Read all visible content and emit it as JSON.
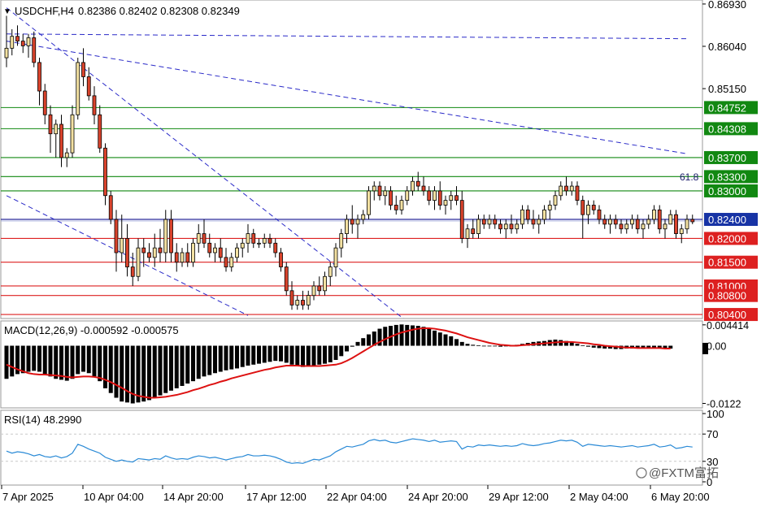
{
  "header": {
    "arrow": "▼",
    "symbol": "USDCHF,H4",
    "ohlc": "0.82386 0.82402 0.82308 0.82349"
  },
  "fib_label": "61.8",
  "macd_label": "MACD(12,26,9) -0.000592 -0.000575",
  "rsi_label": "RSI(14) 48.2990",
  "watermark": "@FXTM富拓",
  "colors": {
    "up_candle": "#f3e1a2",
    "down_candle": "#d9432c",
    "wick": "#000000",
    "support": "#dd2020",
    "resistance": "#118811",
    "current": "#2a2a9a",
    "trendline": "#2a2ac8",
    "price_tag": "#1733a5",
    "macd_signal": "#dd1111",
    "rsi_line": "#2a8ad6",
    "grid": "#c9c9c9"
  },
  "chart_data": {
    "type": "candlestick",
    "title": "USDCHF,H4",
    "y_axis_price_ticks": [
      "0.86930",
      "0.86040",
      "0.85150"
    ],
    "ylim": [
      0.8035,
      0.8698
    ],
    "level_lines": [
      {
        "label": "0.84752",
        "value": 0.84752,
        "kind": "resistance"
      },
      {
        "label": "0.84308",
        "value": 0.84308,
        "kind": "resistance"
      },
      {
        "label": "0.83700",
        "value": 0.837,
        "kind": "resistance"
      },
      {
        "label": "0.83300",
        "value": 0.833,
        "kind": "resistance"
      },
      {
        "label": "0.83000",
        "value": 0.83,
        "kind": "resistance"
      },
      {
        "label": "0.82400",
        "value": 0.824,
        "kind": "current"
      },
      {
        "label": "0.82000",
        "value": 0.82,
        "kind": "support"
      },
      {
        "label": "0.81500",
        "value": 0.815,
        "kind": "support"
      },
      {
        "label": "0.81000",
        "value": 0.81,
        "kind": "support"
      },
      {
        "label": "0.80800",
        "value": 0.808,
        "kind": "support"
      },
      {
        "label": "0.80400",
        "value": 0.804,
        "kind": "support"
      }
    ],
    "x_tick_labels": [
      "7 Apr 2025",
      "10 Apr 04:00",
      "14 Apr 20:00",
      "17 Apr 12:00",
      "22 Apr 04:00",
      "24 Apr 20:00",
      "29 Apr 12:00",
      "2 May 04:00",
      "6 May 20:00"
    ],
    "ohlc": [
      [
        0.858,
        0.8668,
        0.856,
        0.86
      ],
      [
        0.86,
        0.864,
        0.8585,
        0.8625
      ],
      [
        0.8625,
        0.8648,
        0.8605,
        0.8615
      ],
      [
        0.8615,
        0.863,
        0.859,
        0.8605
      ],
      [
        0.8605,
        0.863,
        0.858,
        0.8622
      ],
      [
        0.8622,
        0.8635,
        0.856,
        0.857
      ],
      [
        0.857,
        0.858,
        0.848,
        0.851
      ],
      [
        0.851,
        0.8525,
        0.844,
        0.846
      ],
      [
        0.846,
        0.848,
        0.838,
        0.842
      ],
      [
        0.842,
        0.845,
        0.837,
        0.844
      ],
      [
        0.844,
        0.846,
        0.835,
        0.837
      ],
      [
        0.837,
        0.839,
        0.835,
        0.838
      ],
      [
        0.838,
        0.848,
        0.837,
        0.846
      ],
      [
        0.846,
        0.858,
        0.845,
        0.857
      ],
      [
        0.857,
        0.86,
        0.852,
        0.854
      ],
      [
        0.854,
        0.856,
        0.849,
        0.85
      ],
      [
        0.85,
        0.852,
        0.844,
        0.846
      ],
      [
        0.846,
        0.848,
        0.838,
        0.839
      ],
      [
        0.839,
        0.84,
        0.827,
        0.829
      ],
      [
        0.829,
        0.83,
        0.823,
        0.824
      ],
      [
        0.824,
        0.826,
        0.813,
        0.817
      ],
      [
        0.817,
        0.825,
        0.815,
        0.82
      ],
      [
        0.82,
        0.823,
        0.812,
        0.814
      ],
      [
        0.814,
        0.817,
        0.81,
        0.812
      ],
      [
        0.812,
        0.82,
        0.811,
        0.818
      ],
      [
        0.818,
        0.82,
        0.814,
        0.817
      ],
      [
        0.817,
        0.819,
        0.815,
        0.816
      ],
      [
        0.816,
        0.821,
        0.814,
        0.818
      ],
      [
        0.818,
        0.822,
        0.815,
        0.817
      ],
      [
        0.817,
        0.826,
        0.815,
        0.824
      ],
      [
        0.824,
        0.826,
        0.815,
        0.817
      ],
      [
        0.817,
        0.819,
        0.813,
        0.815
      ],
      [
        0.815,
        0.818,
        0.814,
        0.817
      ],
      [
        0.817,
        0.819,
        0.814,
        0.815
      ],
      [
        0.815,
        0.82,
        0.814,
        0.819
      ],
      [
        0.819,
        0.823,
        0.817,
        0.821
      ],
      [
        0.821,
        0.824,
        0.818,
        0.819
      ],
      [
        0.819,
        0.821,
        0.816,
        0.817
      ],
      [
        0.817,
        0.819,
        0.815,
        0.818
      ],
      [
        0.818,
        0.82,
        0.815,
        0.816
      ],
      [
        0.816,
        0.818,
        0.813,
        0.814
      ],
      [
        0.814,
        0.817,
        0.813,
        0.816
      ],
      [
        0.816,
        0.819,
        0.815,
        0.818
      ],
      [
        0.818,
        0.82,
        0.816,
        0.819
      ],
      [
        0.819,
        0.823,
        0.817,
        0.821
      ],
      [
        0.821,
        0.822,
        0.818,
        0.819
      ],
      [
        0.819,
        0.82,
        0.818,
        0.819
      ],
      [
        0.819,
        0.821,
        0.818,
        0.82
      ],
      [
        0.82,
        0.821,
        0.818,
        0.819
      ],
      [
        0.819,
        0.82,
        0.816,
        0.817
      ],
      [
        0.817,
        0.818,
        0.813,
        0.814
      ],
      [
        0.814,
        0.815,
        0.808,
        0.809
      ],
      [
        0.809,
        0.811,
        0.805,
        0.806
      ],
      [
        0.806,
        0.808,
        0.805,
        0.807
      ],
      [
        0.807,
        0.809,
        0.805,
        0.806
      ],
      [
        0.806,
        0.809,
        0.805,
        0.808
      ],
      [
        0.808,
        0.811,
        0.807,
        0.81
      ],
      [
        0.81,
        0.812,
        0.808,
        0.809
      ],
      [
        0.809,
        0.813,
        0.808,
        0.812
      ],
      [
        0.812,
        0.815,
        0.81,
        0.814
      ],
      [
        0.814,
        0.819,
        0.812,
        0.818
      ],
      [
        0.818,
        0.822,
        0.816,
        0.821
      ],
      [
        0.821,
        0.825,
        0.819,
        0.824
      ],
      [
        0.824,
        0.827,
        0.821,
        0.823
      ],
      [
        0.823,
        0.825,
        0.82,
        0.824
      ],
      [
        0.824,
        0.826,
        0.823,
        0.825
      ],
      [
        0.825,
        0.831,
        0.824,
        0.83
      ],
      [
        0.83,
        0.832,
        0.828,
        0.831
      ],
      [
        0.831,
        0.832,
        0.828,
        0.829
      ],
      [
        0.829,
        0.831,
        0.827,
        0.83
      ],
      [
        0.83,
        0.831,
        0.826,
        0.827
      ],
      [
        0.827,
        0.829,
        0.825,
        0.826
      ],
      [
        0.826,
        0.829,
        0.825,
        0.828
      ],
      [
        0.828,
        0.831,
        0.827,
        0.83
      ],
      [
        0.83,
        0.833,
        0.829,
        0.832
      ],
      [
        0.832,
        0.834,
        0.83,
        0.831
      ],
      [
        0.831,
        0.833,
        0.829,
        0.83
      ],
      [
        0.83,
        0.831,
        0.827,
        0.828
      ],
      [
        0.828,
        0.831,
        0.826,
        0.83
      ],
      [
        0.83,
        0.832,
        0.826,
        0.827
      ],
      [
        0.827,
        0.829,
        0.825,
        0.828
      ],
      [
        0.828,
        0.83,
        0.826,
        0.829
      ],
      [
        0.829,
        0.831,
        0.827,
        0.828
      ],
      [
        0.828,
        0.83,
        0.819,
        0.82
      ],
      [
        0.82,
        0.823,
        0.818,
        0.822
      ],
      [
        0.822,
        0.824,
        0.82,
        0.821
      ],
      [
        0.821,
        0.825,
        0.82,
        0.824
      ],
      [
        0.824,
        0.825,
        0.822,
        0.823
      ],
      [
        0.823,
        0.825,
        0.822,
        0.824
      ],
      [
        0.824,
        0.825,
        0.822,
        0.823
      ],
      [
        0.823,
        0.824,
        0.821,
        0.822
      ],
      [
        0.822,
        0.824,
        0.82,
        0.823
      ],
      [
        0.823,
        0.825,
        0.821,
        0.822
      ],
      [
        0.822,
        0.824,
        0.821,
        0.823
      ],
      [
        0.823,
        0.827,
        0.822,
        0.826
      ],
      [
        0.826,
        0.827,
        0.823,
        0.824
      ],
      [
        0.824,
        0.826,
        0.822,
        0.823
      ],
      [
        0.823,
        0.825,
        0.821,
        0.824
      ],
      [
        0.824,
        0.827,
        0.823,
        0.826
      ],
      [
        0.826,
        0.828,
        0.824,
        0.827
      ],
      [
        0.827,
        0.83,
        0.826,
        0.829
      ],
      [
        0.829,
        0.832,
        0.828,
        0.831
      ],
      [
        0.831,
        0.833,
        0.829,
        0.83
      ],
      [
        0.83,
        0.832,
        0.829,
        0.831
      ],
      [
        0.831,
        0.832,
        0.827,
        0.828
      ],
      [
        0.828,
        0.829,
        0.82,
        0.825
      ],
      [
        0.825,
        0.828,
        0.823,
        0.827
      ],
      [
        0.827,
        0.828,
        0.825,
        0.826
      ],
      [
        0.826,
        0.827,
        0.823,
        0.824
      ],
      [
        0.824,
        0.825,
        0.822,
        0.823
      ],
      [
        0.823,
        0.825,
        0.821,
        0.824
      ],
      [
        0.824,
        0.825,
        0.822,
        0.823
      ],
      [
        0.823,
        0.824,
        0.821,
        0.822
      ],
      [
        0.822,
        0.824,
        0.821,
        0.823
      ],
      [
        0.823,
        0.825,
        0.822,
        0.824
      ],
      [
        0.824,
        0.825,
        0.821,
        0.822
      ],
      [
        0.822,
        0.824,
        0.82,
        0.823
      ],
      [
        0.823,
        0.825,
        0.822,
        0.824
      ],
      [
        0.824,
        0.827,
        0.823,
        0.826
      ],
      [
        0.826,
        0.827,
        0.821,
        0.822
      ],
      [
        0.822,
        0.824,
        0.82,
        0.823
      ],
      [
        0.823,
        0.826,
        0.823,
        0.825
      ],
      [
        0.825,
        0.826,
        0.82,
        0.821
      ],
      [
        0.821,
        0.823,
        0.819,
        0.822
      ],
      [
        0.822,
        0.825,
        0.821,
        0.824
      ],
      [
        0.824,
        0.825,
        0.823,
        0.8235
      ]
    ],
    "trendlines": [
      {
        "from": [
          0,
          0.8685
        ],
        "to": [
          78,
          0.798
        ]
      },
      {
        "from": [
          0,
          0.863
        ],
        "to": [
          124,
          0.862
        ]
      },
      {
        "from": [
          0,
          0.8615
        ],
        "to": [
          124,
          0.8378
        ]
      },
      {
        "from": [
          0,
          0.829
        ],
        "to": [
          44,
          0.8038
        ]
      }
    ],
    "macd": {
      "label": "MACD(12,26,9)",
      "value": -0.000592,
      "signal_value": -0.000575,
      "y_ticks": [
        "0.004414",
        "0.00",
        "-0.0122"
      ],
      "ylim": [
        -0.0128,
        0.0049
      ],
      "histogram": [
        -0.007,
        -0.0065,
        -0.006,
        -0.0058,
        -0.0055,
        -0.0053,
        -0.0055,
        -0.006,
        -0.0065,
        -0.007,
        -0.0072,
        -0.0074,
        -0.007,
        -0.006,
        -0.0055,
        -0.0058,
        -0.0065,
        -0.0075,
        -0.009,
        -0.01,
        -0.011,
        -0.0118,
        -0.012,
        -0.0122,
        -0.012,
        -0.0118,
        -0.0115,
        -0.011,
        -0.0105,
        -0.01,
        -0.0095,
        -0.009,
        -0.0085,
        -0.008,
        -0.0075,
        -0.007,
        -0.0065,
        -0.0062,
        -0.0058,
        -0.0055,
        -0.0052,
        -0.005,
        -0.0048,
        -0.0045,
        -0.0042,
        -0.004,
        -0.0038,
        -0.0036,
        -0.0034,
        -0.0032,
        -0.0033,
        -0.0036,
        -0.004,
        -0.0043,
        -0.0045,
        -0.0044,
        -0.0042,
        -0.004,
        -0.0038,
        -0.0035,
        -0.003,
        -0.0022,
        -0.0012,
        -0.0002,
        0.0008,
        0.0016,
        0.0024,
        0.003,
        0.0036,
        0.004,
        0.0042,
        0.0044,
        0.0045,
        0.0044,
        0.0043,
        0.0042,
        0.004,
        0.0036,
        0.0032,
        0.0028,
        0.0024,
        0.002,
        0.0014,
        0.0008,
        0.0004,
        0.0002,
        0.0001,
        0.0,
        -0.0001,
        -0.0001,
        -0.0002,
        -0.0001,
        0.0,
        0.0002,
        0.0004,
        0.0006,
        0.0008,
        0.0009,
        0.001,
        0.0012,
        0.0013,
        0.0012,
        0.001,
        0.0007,
        0.0004,
        0.0001,
        -0.0002,
        -0.0004,
        -0.0005,
        -0.0006,
        -0.0006,
        -0.0007,
        -0.0007,
        -0.0006,
        -0.0006,
        -0.0005,
        -0.0006,
        -0.0006,
        -0.0005,
        -0.0006,
        -0.0006,
        -0.0006
      ],
      "signal": [
        -0.004,
        -0.0045,
        -0.005,
        -0.0054,
        -0.0058,
        -0.006,
        -0.0061,
        -0.0061,
        -0.0062,
        -0.0063,
        -0.0064,
        -0.0066,
        -0.0067,
        -0.0066,
        -0.0065,
        -0.0065,
        -0.0066,
        -0.0068,
        -0.0072,
        -0.0077,
        -0.0083,
        -0.0089,
        -0.0096,
        -0.0102,
        -0.0106,
        -0.0108,
        -0.011,
        -0.011,
        -0.0109,
        -0.0108,
        -0.0106,
        -0.0104,
        -0.0101,
        -0.0098,
        -0.0094,
        -0.0091,
        -0.0087,
        -0.0083,
        -0.008,
        -0.0076,
        -0.0073,
        -0.0069,
        -0.0066,
        -0.0063,
        -0.006,
        -0.0057,
        -0.0054,
        -0.0051,
        -0.0049,
        -0.0046,
        -0.0044,
        -0.0042,
        -0.0042,
        -0.0042,
        -0.0043,
        -0.0043,
        -0.0043,
        -0.0043,
        -0.0042,
        -0.0041,
        -0.004,
        -0.0037,
        -0.0032,
        -0.0026,
        -0.0019,
        -0.0012,
        -0.0005,
        0.0002,
        0.0008,
        0.0014,
        0.0019,
        0.0024,
        0.0028,
        0.0031,
        0.0034,
        0.0036,
        0.0037,
        0.0037,
        0.0036,
        0.0034,
        0.0032,
        0.0029,
        0.0026,
        0.0022,
        0.0018,
        0.0015,
        0.0012,
        0.0009,
        0.0006,
        0.0004,
        0.0002,
        0.0001,
        0.0,
        0.0,
        0.0001,
        0.0002,
        0.0003,
        0.0004,
        0.0005,
        0.0006,
        0.0007,
        0.0008,
        0.0008,
        0.0008,
        0.0007,
        0.0006,
        0.0005,
        0.0003,
        0.0002,
        0.0,
        -0.0001,
        -0.0002,
        -0.0003,
        -0.0004,
        -0.0004,
        -0.0005,
        -0.0005,
        -0.0005,
        -0.0005,
        -0.0005,
        -0.0006,
        -0.0006
      ]
    },
    "rsi": {
      "label": "RSI(14)",
      "value": 48.299,
      "y_ticks": [
        "100",
        "70",
        "30",
        "0"
      ],
      "levels": [
        70,
        30
      ],
      "ylim": [
        0,
        100
      ],
      "values": [
        45,
        42,
        44,
        43,
        41,
        38,
        40,
        37,
        36,
        38,
        35,
        37,
        42,
        55,
        52,
        48,
        45,
        42,
        36,
        33,
        30,
        32,
        30,
        29,
        34,
        33,
        32,
        34,
        33,
        38,
        35,
        33,
        34,
        33,
        36,
        38,
        37,
        35,
        36,
        34,
        32,
        34,
        36,
        37,
        40,
        38,
        38,
        39,
        38,
        36,
        33,
        29,
        27,
        28,
        27,
        30,
        33,
        32,
        35,
        38,
        44,
        48,
        52,
        51,
        53,
        55,
        60,
        62,
        60,
        61,
        58,
        57,
        59,
        61,
        63,
        62,
        61,
        59,
        61,
        58,
        59,
        60,
        59,
        48,
        52,
        51,
        54,
        53,
        54,
        53,
        52,
        53,
        52,
        53,
        56,
        54,
        53,
        54,
        56,
        57,
        59,
        61,
        60,
        61,
        58,
        52,
        55,
        54,
        53,
        52,
        53,
        52,
        51,
        52,
        53,
        51,
        52,
        53,
        55,
        51,
        52,
        54,
        49,
        50,
        52,
        51
      ]
    }
  }
}
